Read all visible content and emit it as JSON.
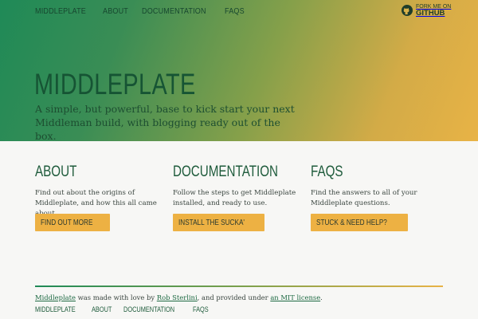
{
  "nav": {
    "items": [
      "MIDDLEPLATE",
      "ABOUT",
      "DOCUMENTATION",
      "FAQS"
    ]
  },
  "fork": {
    "line1": "FORK ME ON",
    "line2": "GITHUB",
    "icon": "github-icon"
  },
  "hero": {
    "title": "MIDDLEPLATE",
    "subtitle": "A simple, but powerful, base to kick start your next Middleman build, with blogging ready out of the box."
  },
  "columns": [
    {
      "heading": "ABOUT",
      "text": "Find out about the origins of Middleplate, and how this all came about.",
      "button": "FIND OUT MORE"
    },
    {
      "heading": "DOCUMENTATION",
      "text": "Follow the steps to get Middleplate installed, and ready to use.",
      "button": "INSTALL THE SUCKA'"
    },
    {
      "heading": "FAQS",
      "text": "Find the answers to all of your Middleplate questions.",
      "button": "STUCK & NEED HELP?"
    }
  ],
  "footer": {
    "link1": "Middleplate",
    "text1": " was made with love by ",
    "link2": "Rob Sterlini",
    "text2": ", and provided under ",
    "link3": "an MIT license",
    "text3": ".",
    "nav": [
      "MIDDLEPLATE",
      "ABOUT",
      "DOCUMENTATION",
      "FAQS"
    ]
  },
  "colors": {
    "gradient_start": "#1f8a57",
    "gradient_end": "#e8b346",
    "button": "#edb143",
    "heading": "#1e5b3b"
  }
}
